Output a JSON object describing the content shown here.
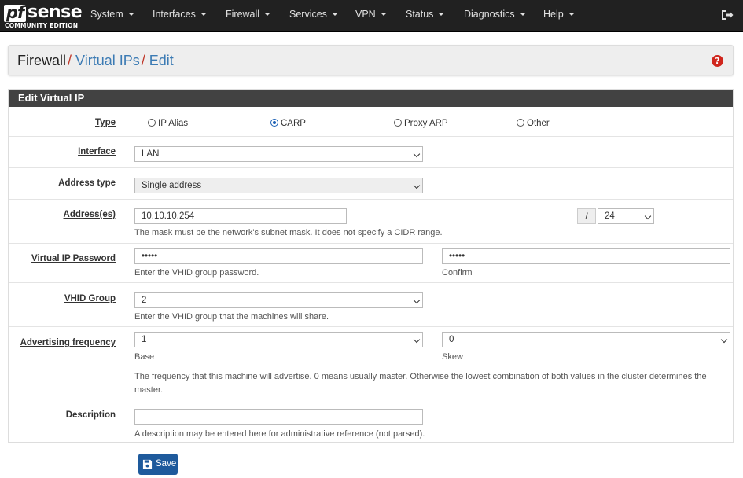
{
  "nav": {
    "logo": {
      "pf": "pf",
      "sense": "sense",
      "edition": "COMMUNITY EDITION"
    },
    "items": [
      "System",
      "Interfaces",
      "Firewall",
      "Services",
      "VPN",
      "Status",
      "Diagnostics",
      "Help"
    ],
    "logout_icon": "sign-out-icon"
  },
  "breadcrumb": {
    "root": "Firewall",
    "sep": "/",
    "item1": "Virtual IPs",
    "item2": "Edit",
    "help_icon": "question-circle-icon"
  },
  "panel": {
    "title": "Edit Virtual IP",
    "type": {
      "label": "Type",
      "options": [
        "IP Alias",
        "CARP",
        "Proxy ARP",
        "Other"
      ],
      "selected": "CARP"
    },
    "interface": {
      "label": "Interface",
      "value": "LAN"
    },
    "address_type": {
      "label": "Address type",
      "value": "Single address"
    },
    "address": {
      "label": "Address(es)",
      "value": "10.10.10.254",
      "slash": "/",
      "mask": "24",
      "help": "The mask must be the network's subnet mask. It does not specify a CIDR range."
    },
    "password": {
      "label": "Virtual IP Password",
      "value": "•••••",
      "confirm_value": "•••••",
      "help": "Enter the VHID group password.",
      "confirm_help": "Confirm"
    },
    "vhid": {
      "label": "VHID Group",
      "value": "2",
      "help": "Enter the VHID group that the machines will share."
    },
    "advfreq": {
      "label": "Advertising frequency",
      "base_value": "1",
      "base_help": "Base",
      "skew_value": "0",
      "skew_help": "Skew",
      "help_line1": "The frequency that this machine will advertise. 0 means usually master. Otherwise the lowest combination of both values in the cluster determines the",
      "help_line2": "master."
    },
    "description": {
      "label": "Description",
      "value": "",
      "help": "A description may be entered here for administrative reference (not parsed)."
    }
  },
  "save_button": {
    "label": "Save",
    "icon": "floppy-disk-icon"
  },
  "colors": {
    "navbar": "#212121",
    "panel_heading": "#424242",
    "link": "#3c7bb4",
    "crumb_sep": "#c0392b",
    "save": "#1e5a9c",
    "help_icon": "#d0261d"
  }
}
